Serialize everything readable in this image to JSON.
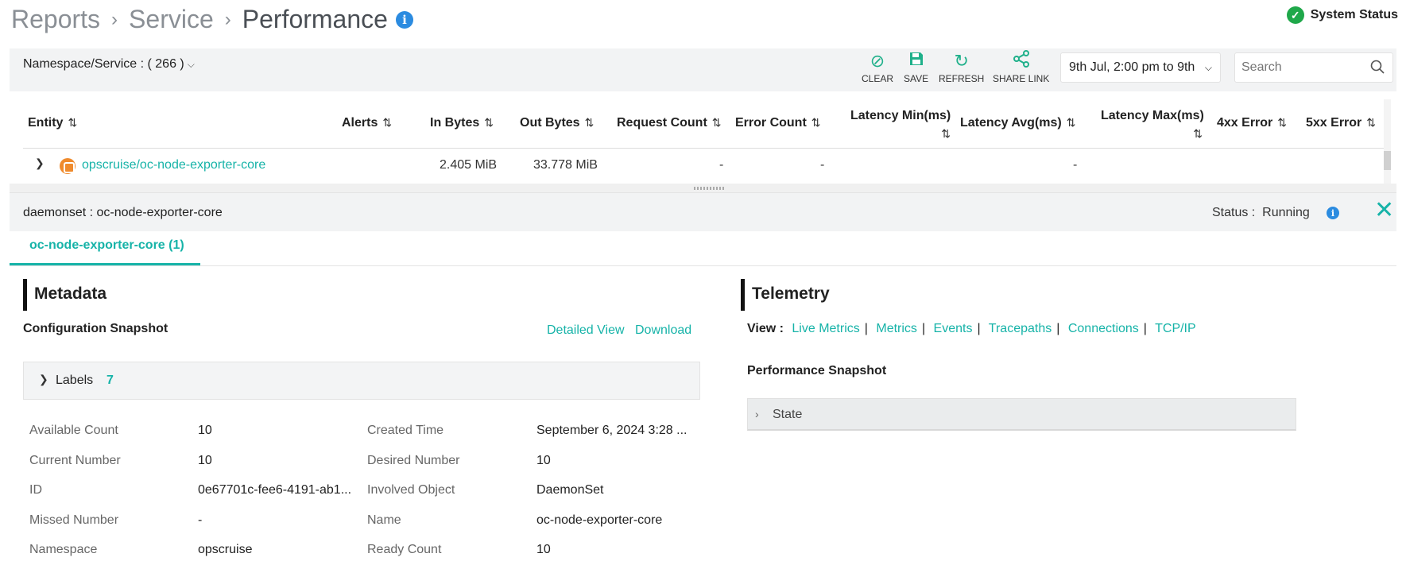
{
  "breadcrumb": [
    "Reports",
    "Service",
    "Performance"
  ],
  "system_status": "System Status",
  "toolbar": {
    "namespace_label": "Namespace/Service : ( 266 )",
    "clear": "CLEAR",
    "save": "SAVE",
    "refresh": "REFRESH",
    "share": "SHARE LINK",
    "date_range": "9th Jul, 2:00 pm to 9th",
    "search_placeholder": "Search"
  },
  "table": {
    "headers": {
      "entity": "Entity",
      "alerts": "Alerts",
      "in_bytes": "In Bytes",
      "out_bytes": "Out Bytes",
      "request_count": "Request Count",
      "error_count": "Error Count",
      "latency_min": "Latency Min(ms)",
      "latency_avg": "Latency Avg(ms)",
      "latency_max": "Latency Max(ms)",
      "err4xx": "4xx Error",
      "err5xx": "5xx Error"
    },
    "row": {
      "entity": "opscruise/oc-node-exporter-core",
      "in_bytes": "2.405 MiB",
      "out_bytes": "33.778 MiB",
      "request_count": "-",
      "error_count": "-",
      "latency_avg": "-"
    }
  },
  "detail": {
    "title": "daemonset : oc-node-exporter-core",
    "status": "Status :  Running",
    "tab": "oc-node-exporter-core (1)"
  },
  "metadata": {
    "title": "Metadata",
    "config_snapshot": "Configuration Snapshot",
    "detailed_view": "Detailed View",
    "download": "Download",
    "labels": "Labels",
    "labels_count": "7",
    "fields": [
      {
        "k": "Available Count",
        "v": "10",
        "k2": "Created Time",
        "v2": "September 6, 2024 3:28 ..."
      },
      {
        "k": "Current Number",
        "v": "10",
        "k2": "Desired Number",
        "v2": "10"
      },
      {
        "k": "ID",
        "v": "0e67701c-fee6-4191-ab1...",
        "k2": "Involved Object",
        "v2": "DaemonSet"
      },
      {
        "k": "Missed Number",
        "v": "-",
        "k2": "Name",
        "v2": "oc-node-exporter-core"
      },
      {
        "k": "Namespace",
        "v": "opscruise",
        "k2": "Ready Count",
        "v2": "10"
      }
    ]
  },
  "telemetry": {
    "title": "Telemetry",
    "view_label": "View :",
    "links": [
      "Live Metrics",
      "Metrics",
      "Events",
      "Tracepaths",
      "Connections",
      "TCP/IP"
    ],
    "perf_snapshot": "Performance Snapshot",
    "state": "State"
  },
  "colors": {
    "accent": "#16b3a8",
    "info": "#2b8be0",
    "ok": "#1fa84a",
    "entity_icon": "#ef8a2c"
  }
}
